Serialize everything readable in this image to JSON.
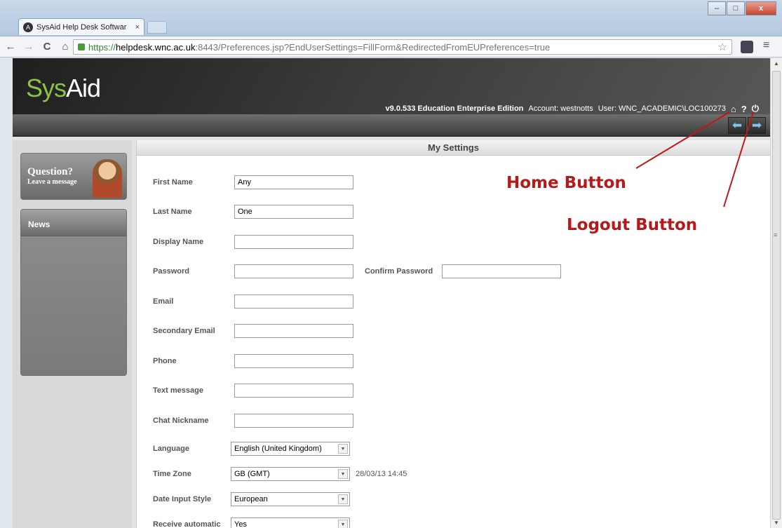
{
  "browser": {
    "tab_title": "SysAid Help Desk Softwar",
    "tab_close": "×",
    "url_scheme": "https://",
    "url_host": "helpdesk.wnc.ac.uk",
    "url_path": ":8443/Preferences.jsp?EndUserSettings=FillForm&RedirectedFromEUPreferences=true",
    "back": "←",
    "forward": "→",
    "reload": "C",
    "home": "⌂",
    "star": "☆",
    "menu": "≡",
    "min": "–",
    "max": "□",
    "close": "x"
  },
  "header": {
    "logo_a": "Sys",
    "logo_b": "Aid",
    "version": "v9.0.533 Education Enterprise Edition",
    "account": "Account: westnotts",
    "user": "User: WNC_ACADEMIC\\LOC100273",
    "home_icon": "⌂",
    "help_icon": "?",
    "logout_icon": "⏻"
  },
  "nav_arrows": {
    "left": "⬅",
    "right": "➡"
  },
  "sidebar": {
    "q_title": "Question?",
    "q_sub": "Leave a message",
    "news": "News"
  },
  "main": {
    "title": "My Settings"
  },
  "form": {
    "first_name": {
      "label": "First Name",
      "value": "Any"
    },
    "last_name": {
      "label": "Last Name",
      "value": "One"
    },
    "display_name": {
      "label": "Display Name",
      "value": ""
    },
    "password": {
      "label": "Password",
      "value": ""
    },
    "confirm_password": {
      "label": "Confirm Password",
      "value": ""
    },
    "email": {
      "label": "Email",
      "value": ""
    },
    "secondary_email": {
      "label": "Secondary Email",
      "value": ""
    },
    "phone": {
      "label": "Phone",
      "value": ""
    },
    "text_message": {
      "label": "Text message",
      "value": ""
    },
    "chat_nickname": {
      "label": "Chat Nickname",
      "value": ""
    },
    "language": {
      "label": "Language",
      "value": "English (United Kingdom)"
    },
    "time_zone": {
      "label": "Time Zone",
      "value": "GB (GMT)",
      "time": "28/03/13 14:45"
    },
    "date_style": {
      "label": "Date Input Style",
      "value": "European"
    },
    "receive_auto": {
      "label": "Receive automatic",
      "value": "Yes"
    }
  },
  "annotations": {
    "home": "Home Button",
    "logout": "Logout Button",
    "color": "#b41a1a"
  }
}
